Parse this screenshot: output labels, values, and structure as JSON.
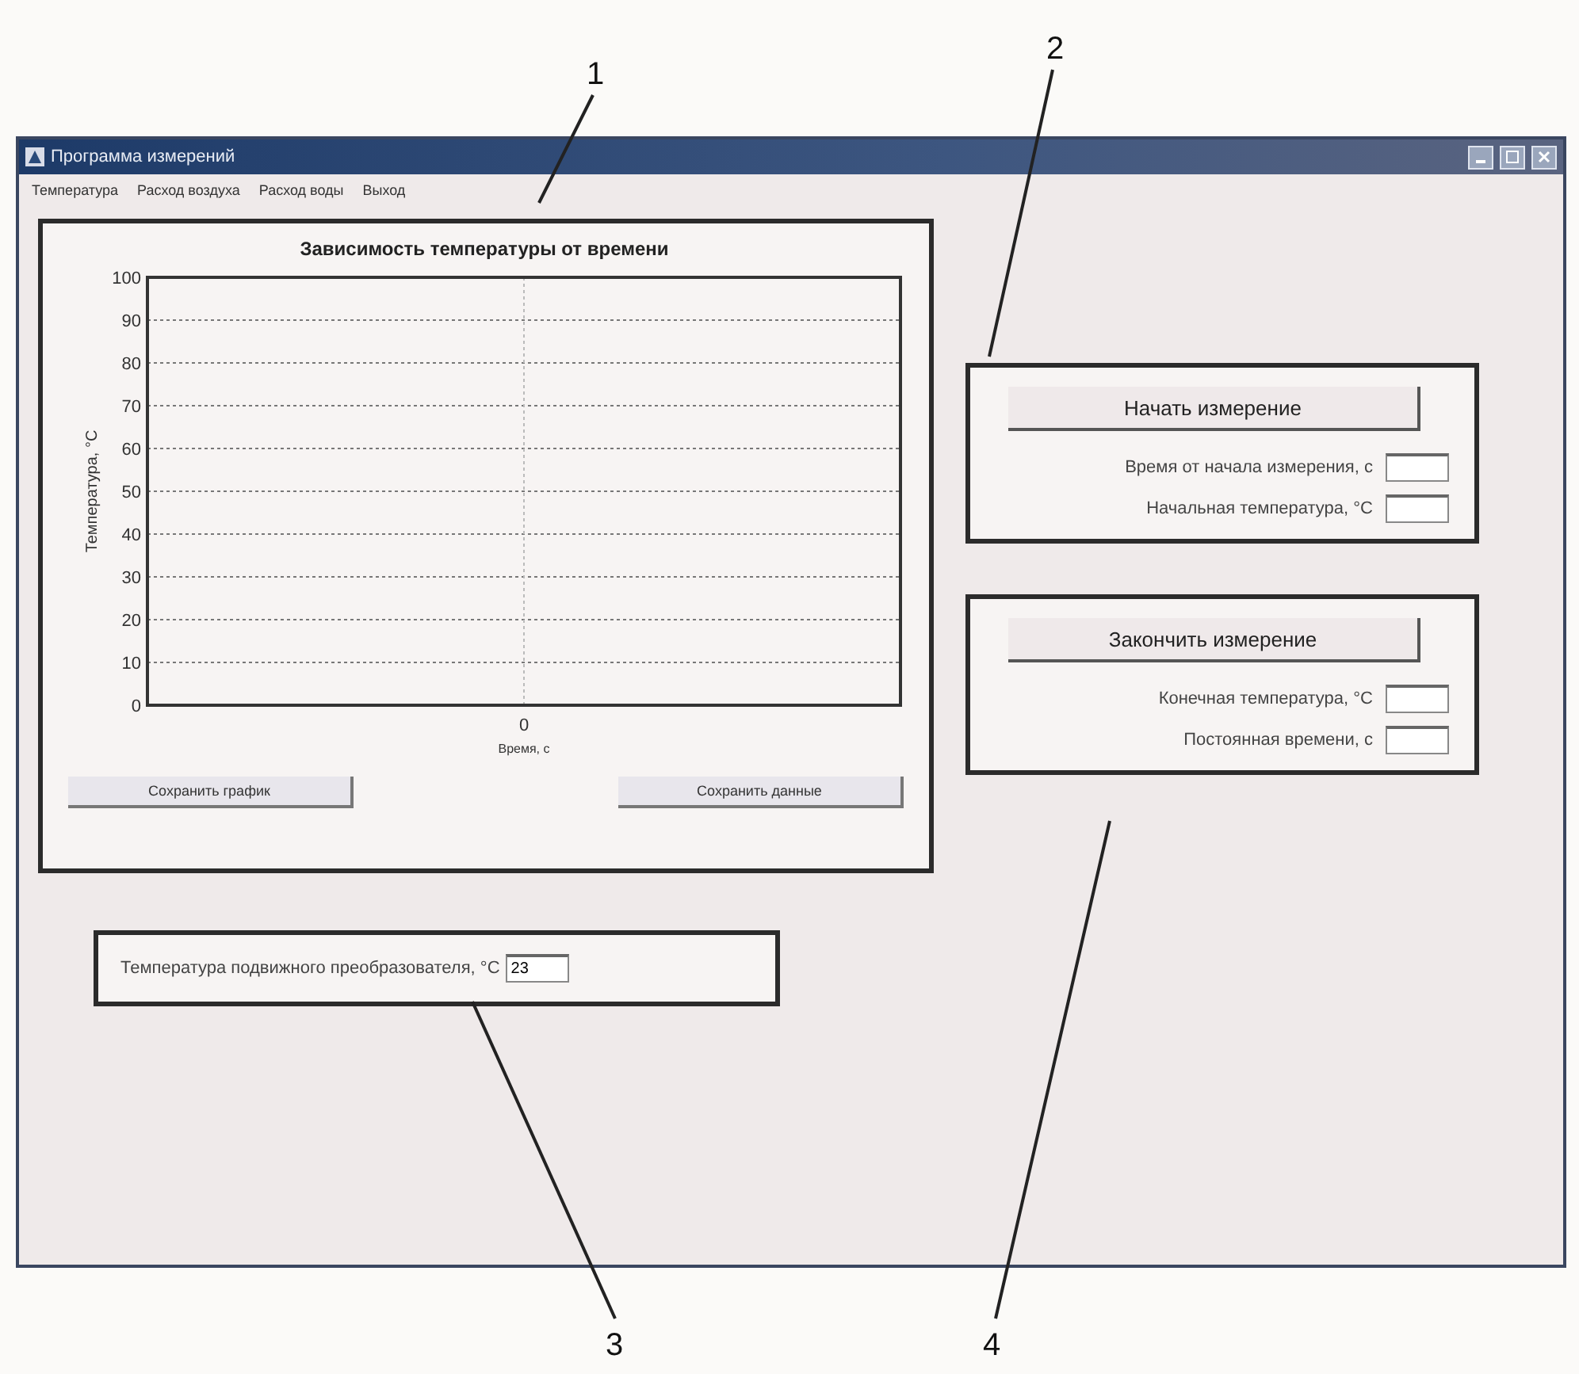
{
  "window": {
    "title": "Программа измерений"
  },
  "menu": [
    "Температура",
    "Расход воздуха",
    "Расход воды",
    "Выход"
  ],
  "chart_panel": {
    "empty_chart": {
      "title": "Зависимость температуры от времени",
      "y_tick_labels": [
        "100",
        "90",
        "80",
        "70",
        "60",
        "50",
        "40",
        "30",
        "20",
        "10",
        "0"
      ],
      "x_tick_labels": [
        "0"
      ],
      "xlabel": "Время, с",
      "ylabel": "Температура, °C"
    },
    "buttons": [
      "Сохранить график",
      "Сохранить данные"
    ]
  },
  "sensor_panel": {
    "label": "Температура подвижного преобразователя, °C",
    "value": "23"
  },
  "start_panel": {
    "button": "Начать измерение",
    "fields": [
      {
        "label": "Время от начала измерения, с"
      },
      {
        "label": "Начальная температура, °C"
      }
    ]
  },
  "end_panel": {
    "button": "Закончить измерение",
    "fields": [
      {
        "label": "Конечная температура, °C"
      },
      {
        "label": "Постоянная времени, с"
      }
    ]
  },
  "callouts": [
    "1",
    "2",
    "3",
    "4"
  ]
}
